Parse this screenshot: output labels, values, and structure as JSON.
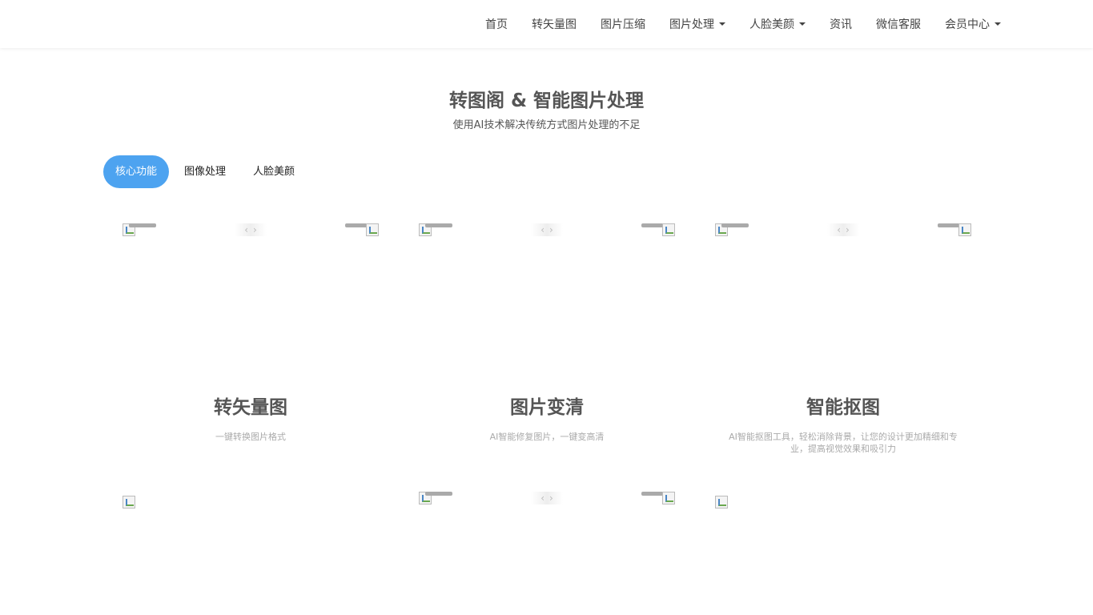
{
  "nav": {
    "items": [
      {
        "label": "首页",
        "dropdown": false
      },
      {
        "label": "转矢量图",
        "dropdown": false
      },
      {
        "label": "图片压缩",
        "dropdown": false
      },
      {
        "label": "图片处理",
        "dropdown": true
      },
      {
        "label": "人脸美颜",
        "dropdown": true
      },
      {
        "label": "资讯",
        "dropdown": false
      },
      {
        "label": "微信客服",
        "dropdown": false
      },
      {
        "label": "会员中心",
        "dropdown": true
      }
    ]
  },
  "hero": {
    "title": "转图阁 & 智能图片处理",
    "subtitle": "使用AI技术解决传统方式图片处理的不足"
  },
  "tabs": [
    {
      "label": "核心功能",
      "active": true
    },
    {
      "label": "图像处理",
      "active": false
    },
    {
      "label": "人脸美颜",
      "active": false
    }
  ],
  "cards": [
    {
      "title": "转矢量图",
      "desc": "一键转换图片格式"
    },
    {
      "title": "图片变清",
      "desc": "AI智能修复图片，一键变高清"
    },
    {
      "title": "智能抠图",
      "desc": "AI智能抠图工具，轻松消除背景，让您的设计更加精细和专业，提高视觉效果和吸引力"
    }
  ],
  "colors": {
    "accent": "#4da3f0",
    "title": "#555555",
    "muted": "#aaaaaa"
  },
  "icons": {
    "prev": "‹",
    "next": "›"
  }
}
